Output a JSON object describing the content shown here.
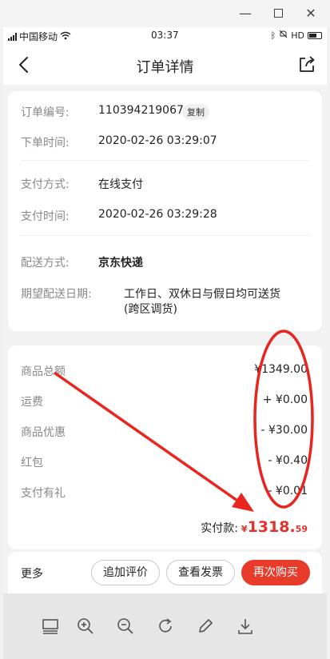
{
  "status": {
    "carrier": "中国移动",
    "time": "03:37"
  },
  "header": {
    "title": "订单详情",
    "back_icon": "chevron-left-icon",
    "share_icon": "share-icon"
  },
  "order": {
    "number_label": "订单编号:",
    "number_value": "110394219067",
    "copy_label": "复制",
    "time_label": "下单时间:",
    "time_value": "2020-02-26 03:29:07",
    "pay_method_label": "支付方式:",
    "pay_method_value": "在线支付",
    "pay_time_label": "支付时间:",
    "pay_time_value": "2020-02-26 03:29:28",
    "delivery_label": "配送方式:",
    "delivery_value": "京东快递",
    "expect_label": "期望配送日期:",
    "expect_value_1": "工作日、双休日与假日均可送货",
    "expect_value_2": "(跨区调货)"
  },
  "amounts": {
    "total_label": "商品总额",
    "total_value": "¥1349.00",
    "shipping_label": "运费",
    "shipping_value": "+ ¥0.00",
    "discount_label": "商品优惠",
    "discount_value": "- ¥30.00",
    "redpacket_label": "红包",
    "redpacket_value": "- ¥0.40",
    "paygift_label": "支付有礼",
    "paygift_value": "- ¥0.01",
    "paid_label": "实付款:",
    "paid_currency": "¥",
    "paid_integer": "1318.",
    "paid_decimal": "59"
  },
  "actions": {
    "more": "更多",
    "review": "追加评价",
    "invoice": "查看发票",
    "rebuy": "再次购买"
  },
  "colors": {
    "accent": "#e93b2a",
    "price": "#e4312a",
    "annotation": "#e8251f"
  }
}
